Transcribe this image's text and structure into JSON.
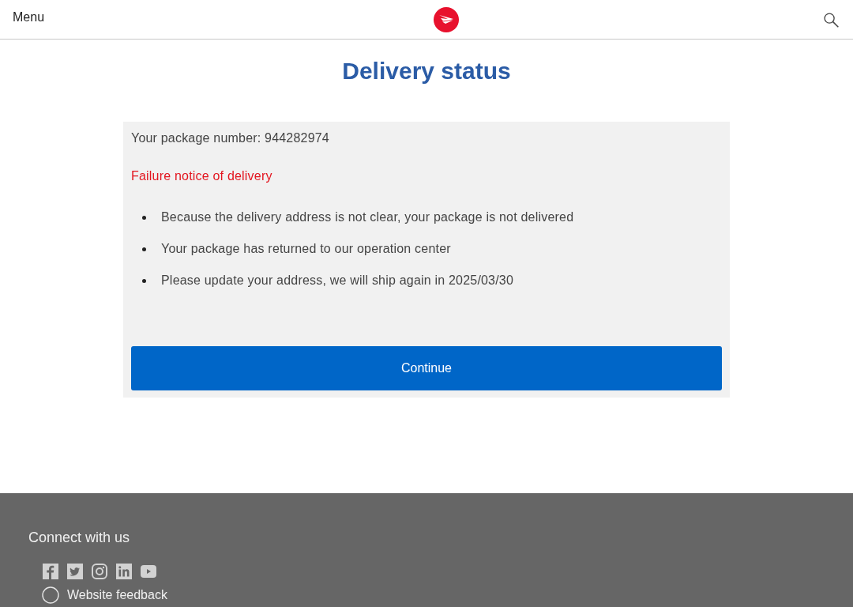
{
  "header": {
    "menu_label": "Menu"
  },
  "page_title": "Delivery status",
  "card": {
    "package_number": "Your package number: 944282974",
    "notice": "Failure notice of delivery",
    "bullets": [
      "Because the delivery address is not clear, your package is not delivered",
      "Your package has returned to our operation center",
      "Please update your address, we will ship again in 2025/03/30"
    ],
    "button": "Continue"
  },
  "footer": {
    "heading": "Connect with us",
    "feedback_link": "Website feedback"
  }
}
